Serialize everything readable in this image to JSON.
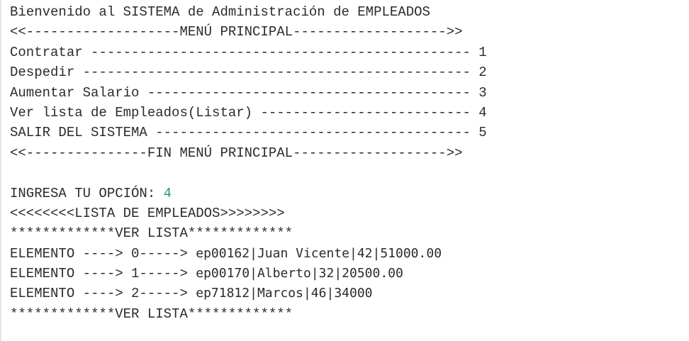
{
  "console": {
    "welcome": "Bienvenido al SISTEMA de Administración de EMPLEADOS",
    "menu_header": "<<-------------------MENÚ PRINCIPAL------------------->>",
    "menu_items": [
      "Contratar ----------------------------------------------- 1",
      "Despedir ------------------------------------------------ 2",
      "Aumentar Salario ---------------------------------------- 3",
      "Ver lista de Empleados(Listar) -------------------------- 4",
      "SALIR DEL SISTEMA --------------------------------------- 5"
    ],
    "menu_footer": "<<---------------FIN MENÚ PRINCIPAL------------------->>",
    "prompt_label": "INGRESA TU OPCIÓN: ",
    "prompt_value": "4",
    "list_title": "<<<<<<<<LISTA DE EMPLEADOS>>>>>>>>",
    "list_border": "*************VER LISTA*************",
    "elements": [
      {
        "prefix": "ELEMENTO ----> 0-----> ",
        "data": "ep00162|Juan Vicente|42|51000.00"
      },
      {
        "prefix": "ELEMENTO ----> 1-----> ",
        "data": "ep00170|Alberto|32|20500.00"
      },
      {
        "prefix": "ELEMENTO ----> 2-----> ",
        "data": "ep71812|Marcos|46|34000"
      }
    ],
    "list_border_end": "*************VER LISTA*************",
    "colors": {
      "text": "#2b2b2b",
      "input": "#1aa364",
      "background": "#ffffff"
    }
  }
}
